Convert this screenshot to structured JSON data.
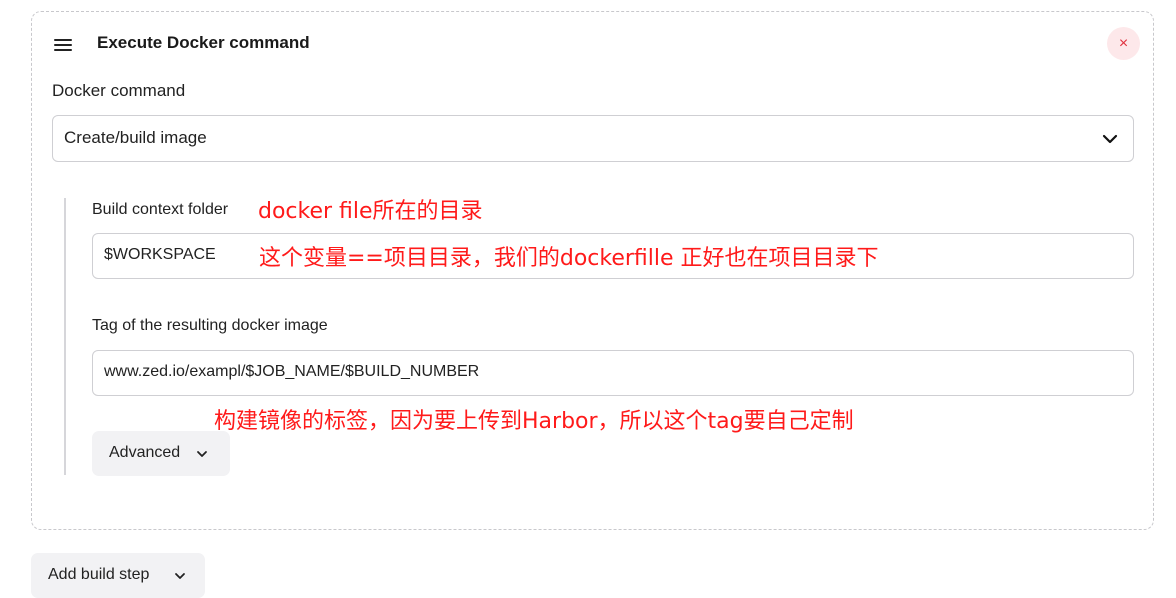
{
  "step": {
    "title": "Execute Docker command",
    "close_icon": "×",
    "docker_command": {
      "label": "Docker command",
      "selected": "Create/build image"
    },
    "build_context": {
      "label": "Build context folder",
      "value": "$WORKSPACE"
    },
    "image_tag": {
      "label": "Tag of the resulting docker image",
      "value": "www.zed.io/exampl/$JOB_NAME/$BUILD_NUMBER"
    },
    "advanced_label": "Advanced"
  },
  "add_build_step_label": "Add build step",
  "annotations": {
    "context_folder_note": "docker file所在的目录",
    "workspace_note": "这个变量==项目目录，我们的dockerfille 正好也在项目目录下",
    "tag_note": "构建镜像的标签，因为要上传到Harbor，所以这个tag要自己定制"
  },
  "colors": {
    "annotation": "#ff1a1a",
    "close_bg": "#fde8ea",
    "close_fg": "#e0303e"
  }
}
